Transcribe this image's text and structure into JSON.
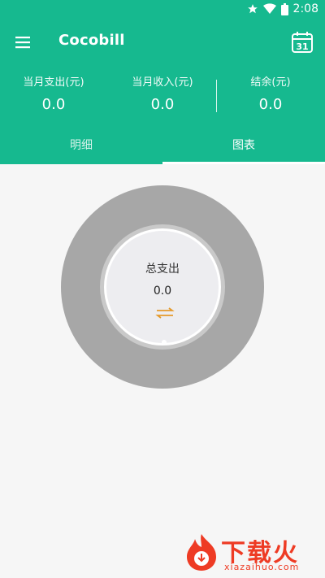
{
  "status_bar": {
    "time": "2:08",
    "icons": [
      "star-icon",
      "wifi-icon",
      "battery-icon"
    ]
  },
  "app_bar": {
    "title": "Cocobill",
    "menu_icon": "menu-icon",
    "calendar_icon": "calendar-icon",
    "calendar_day": "31"
  },
  "summary": {
    "expense_label": "当月支出(元)",
    "expense_value": "0.0",
    "income_label": "当月收入(元)",
    "income_value": "0.0",
    "balance_label": "结余(元)",
    "balance_value": "0.0"
  },
  "tabs": [
    {
      "label": "明细",
      "active": false
    },
    {
      "label": "图表",
      "active": true
    }
  ],
  "chart": {
    "center_label": "总支出",
    "center_value": "0.0",
    "swap_icon": "swap-icon"
  },
  "chart_data": {
    "type": "pie",
    "categories": [],
    "values": []
  },
  "watermark": {
    "brand_text": "下载火",
    "brand_url_text": "xiazaihuo.com"
  },
  "colors": {
    "primary": "#16b98f",
    "donut_empty": "#a7a7a7",
    "center_bg": "#ededf0",
    "swap_accent": "#e59a2b",
    "watermark": "#ee3b24"
  }
}
